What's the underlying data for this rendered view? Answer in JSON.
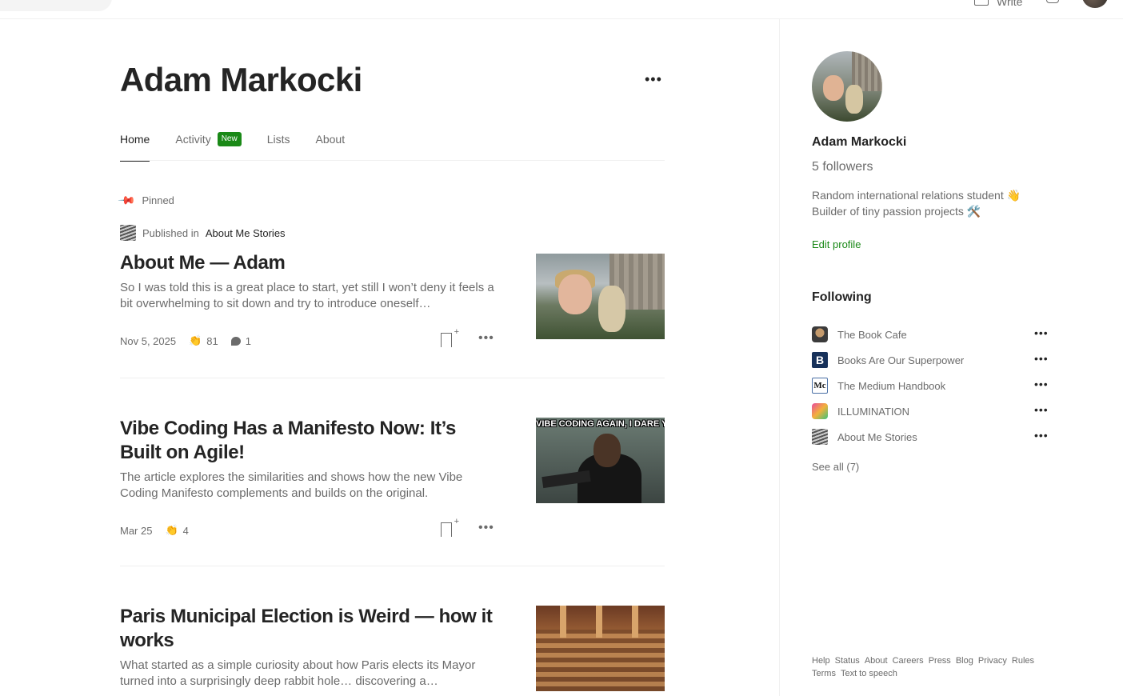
{
  "header": {
    "write_label": "Write"
  },
  "profile": {
    "name": "Adam Markocki",
    "tabs": [
      "Home",
      "Activity",
      "Lists",
      "About"
    ],
    "active_tab": "Home",
    "activity_badge": "New"
  },
  "pinned_label": "Pinned",
  "articles": [
    {
      "published_prefix": "Published in",
      "publication": "About Me Stories",
      "title": "About Me — Adam",
      "subtitle": "So I was told this is a great place to start, yet still I won’t deny it feels a bit overwhelming to sit down and try to introduce oneself…",
      "date": "Nov 5, 2025",
      "claps": "81",
      "comments": "1"
    },
    {
      "title": "Vibe Coding Has a Manifesto Now: It’s Built on Agile!",
      "subtitle": "The article explores the similarities and shows how the new Vibe Coding Manifesto complements and builds on the original.",
      "date": "Mar 25",
      "claps": "4",
      "thumb_text": "VIBE CODING AGAIN, I DARE YOU"
    },
    {
      "title": "Paris Municipal Election is Weird — how it works",
      "subtitle": "What started as a simple curiosity about how Paris elects its Mayor turned into a surprisingly deep rabbit hole… discovering a…"
    }
  ],
  "sidebar": {
    "name": "Adam Markocki",
    "followers": "5 followers",
    "bio_line1": "Random international relations student 👋",
    "bio_line2": "Builder of tiny passion projects 🛠️",
    "edit_profile": "Edit profile",
    "following_heading": "Following",
    "following": [
      {
        "name": "The Book Cafe",
        "logo": "book-cafe-logo"
      },
      {
        "name": "Books Are Our Superpower",
        "logo": "b-logo",
        "logo_text": "B"
      },
      {
        "name": "The Medium Handbook",
        "logo": "medium-handbook-logo",
        "logo_text": "Mc"
      },
      {
        "name": "ILLUMINATION",
        "logo": "illumination-logo"
      },
      {
        "name": "About Me Stories",
        "logo": "about-me-stories-logo"
      }
    ],
    "see_all": "See all (7)",
    "footer": [
      "Help",
      "Status",
      "About",
      "Careers",
      "Press",
      "Blog",
      "Privacy",
      "Rules",
      "Terms",
      "Text to speech"
    ]
  },
  "colors": {
    "accent_green": "#1a8917",
    "text_primary": "#242424",
    "text_secondary": "#6b6b6b",
    "divider": "#f0f0f0"
  }
}
